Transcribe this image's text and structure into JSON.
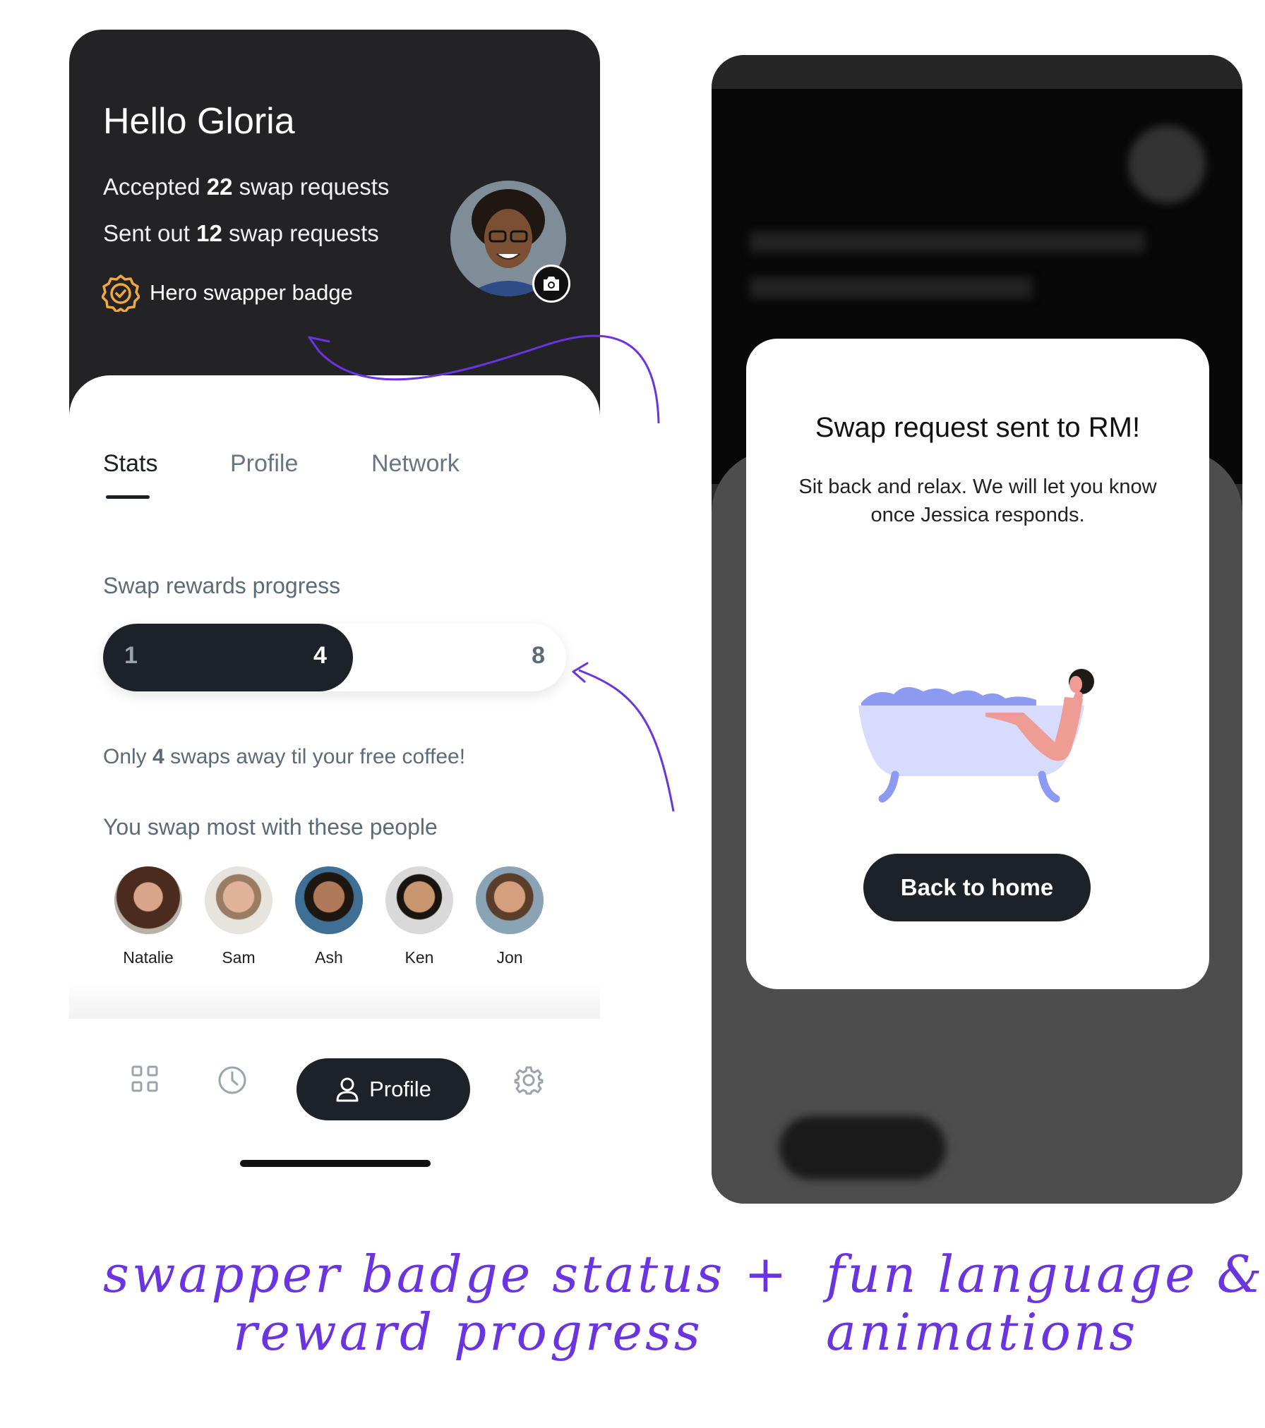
{
  "profile_screen": {
    "greeting": "Hello Gloria",
    "accepted_prefix": "Accepted",
    "accepted_count": "22",
    "accepted_suffix": "swap requests",
    "sent_prefix": "Sent out",
    "sent_count": "12",
    "sent_suffix": "swap requests",
    "badge_label": "Hero swapper badge",
    "tabs": [
      "Stats",
      "Profile",
      "Network"
    ],
    "active_tab": "Stats",
    "rewards_title": "Swap rewards progress",
    "progress": {
      "start": "1",
      "current": "4",
      "goal": "8",
      "fraction": 0.5
    },
    "progress_note_prefix": "Only",
    "progress_note_count": "4",
    "progress_note_suffix": "swaps away til your free coffee!",
    "people_title": "You swap most with these people",
    "people": [
      {
        "name": "Natalie"
      },
      {
        "name": "Sam"
      },
      {
        "name": "Ash"
      },
      {
        "name": "Ken"
      },
      {
        "name": "Jon"
      }
    ],
    "nav": {
      "active_label": "Profile"
    }
  },
  "modal_screen": {
    "title": "Swap request sent to RM!",
    "body": "Sit back and relax. We will let you know once Jessica responds.",
    "button_label": "Back to home"
  },
  "annotations": {
    "left_line1": "swapper badge status +",
    "left_line2": "reward progress",
    "right_line1": "fun language &",
    "right_line2": "animations"
  },
  "colors": {
    "dark": "#232326",
    "accent_badge": "#f2a93b",
    "annotation": "#6a34e0",
    "button_dark": "#1c2227"
  },
  "icons": [
    "badge-icon",
    "camera-icon",
    "grid-icon",
    "clock-icon",
    "user-icon",
    "gear-icon"
  ]
}
